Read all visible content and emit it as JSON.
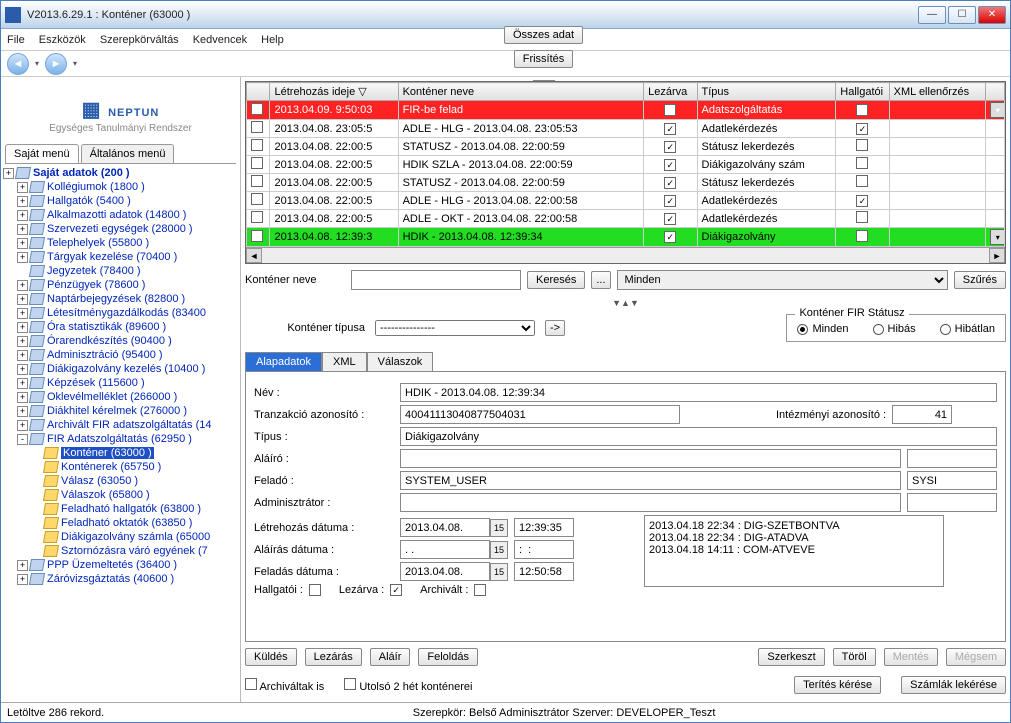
{
  "window": {
    "title": "V2013.6.29.1 : Konténer (63000  )"
  },
  "menu": [
    "File",
    "Eszközök",
    "Szerepkörváltás",
    "Kedvencek",
    "Help"
  ],
  "toolbar": {
    "all": "Összes adat",
    "refresh": "Frissítés"
  },
  "logo": {
    "brand": "NEPTUN",
    "tag": "Egységes Tanulmányi Rendszer"
  },
  "leftTabs": [
    "Saját menü",
    "Általános menü"
  ],
  "tree": [
    {
      "pm": "+",
      "b": true,
      "l": "Saját adatok (200  )"
    },
    {
      "pm": "+",
      "l": "Kollégiumok (1800  )",
      "i": 1
    },
    {
      "pm": "+",
      "l": "Hallgatók (5400  )",
      "i": 1
    },
    {
      "pm": "+",
      "l": "Alkalmazotti adatok (14800  )",
      "i": 1
    },
    {
      "pm": "+",
      "l": "Szervezeti egységek (28000  )",
      "i": 1
    },
    {
      "pm": "+",
      "l": "Telephelyek (55800  )",
      "i": 1
    },
    {
      "pm": "+",
      "l": "Tárgyak kezelése (70400  )",
      "i": 1
    },
    {
      "pm": "",
      "l": "Jegyzetek (78400  )",
      "i": 1
    },
    {
      "pm": "+",
      "l": "Pénzügyek (78600  )",
      "i": 1
    },
    {
      "pm": "+",
      "l": "Naptárbejegyzések (82800  )",
      "i": 1
    },
    {
      "pm": "+",
      "l": "Létesítménygazdálkodás (83400",
      "i": 1
    },
    {
      "pm": "+",
      "l": "Óra statisztikák (89600  )",
      "i": 1
    },
    {
      "pm": "+",
      "l": "Órarendkészítés (90400  )",
      "i": 1
    },
    {
      "pm": "+",
      "l": "Adminisztráció (95400  )",
      "i": 1
    },
    {
      "pm": "+",
      "l": "Diákigazolvány kezelés (10400  )",
      "i": 1
    },
    {
      "pm": "+",
      "l": "Képzések (115600  )",
      "i": 1
    },
    {
      "pm": "+",
      "l": "Oklevélmelléklet (266000  )",
      "i": 1
    },
    {
      "pm": "+",
      "l": "Diákhitel kérelmek (276000  )",
      "i": 1
    },
    {
      "pm": "+",
      "l": "Archivált FIR adatszolgáltatás (14",
      "i": 1
    },
    {
      "pm": "-",
      "l": "FIR Adatszolgáltatás (62950  )",
      "i": 1
    },
    {
      "pm": "",
      "y": true,
      "sel": true,
      "l": "Konténer (63000  )",
      "i": 2
    },
    {
      "pm": "",
      "y": true,
      "l": "Konténerek (65750  )",
      "i": 2
    },
    {
      "pm": "",
      "y": true,
      "l": "Válasz (63050  )",
      "i": 2
    },
    {
      "pm": "",
      "y": true,
      "l": "Válaszok (65800  )",
      "i": 2
    },
    {
      "pm": "",
      "y": true,
      "l": "Feladható hallgatók (63800  )",
      "i": 2
    },
    {
      "pm": "",
      "y": true,
      "l": "Feladható oktatók (63850  )",
      "i": 2
    },
    {
      "pm": "",
      "y": true,
      "l": "Diákigazolvány számla (65000",
      "i": 2
    },
    {
      "pm": "",
      "y": true,
      "l": "Sztornózásra váró egyének (7",
      "i": 2
    },
    {
      "pm": "+",
      "l": "PPP Üzemeltetés (36400  )",
      "i": 1
    },
    {
      "pm": "+",
      "l": "Záróvizsgáztatás (40600  )",
      "i": 1
    }
  ],
  "gridCols": [
    "",
    "Létrehozás ideje",
    "Konténer neve",
    "Lezárva",
    "Típus",
    "Hallgatói",
    "XML ellenőrzés",
    ""
  ],
  "gridRows": [
    {
      "cls": "red",
      "t": "2013.04.09. 9:50:03",
      "n": "FIR-be felad",
      "lz": "✓",
      "tp": "Adatszolgáltatás",
      "h": "✓"
    },
    {
      "t": "2013.04.08. 23:05:5",
      "n": "ADLE - HLG - 2013.04.08. 23:05:53",
      "lz": "✓",
      "tp": "Adatlekérdezés",
      "h": "✓"
    },
    {
      "t": "2013.04.08. 22:00:5",
      "n": "STATUSZ - 2013.04.08. 22:00:59",
      "lz": "✓",
      "tp": "Státusz lekerdezés",
      "h": ""
    },
    {
      "t": "2013.04.08. 22:00:5",
      "n": "HDIK SZLA - 2013.04.08. 22:00:59",
      "lz": "✓",
      "tp": "Diákigazolvány szám",
      "h": ""
    },
    {
      "t": "2013.04.08. 22:00:5",
      "n": "STATUSZ - 2013.04.08. 22:00:59",
      "lz": "✓",
      "tp": "Státusz lekerdezés",
      "h": ""
    },
    {
      "t": "2013.04.08. 22:00:5",
      "n": "ADLE - HLG - 2013.04.08. 22:00:58",
      "lz": "✓",
      "tp": "Adatlekérdezés",
      "h": "✓"
    },
    {
      "t": "2013.04.08. 22:00:5",
      "n": "ADLE - OKT - 2013.04.08. 22:00:58",
      "lz": "✓",
      "tp": "Adatlekérdezés",
      "h": ""
    },
    {
      "cls": "green",
      "t": "2013.04.08. 12:39:3",
      "n": "HDIK - 2013.04.08. 12:39:34",
      "lz": "✓",
      "tp": "Diákigazolvány",
      "h": ""
    }
  ],
  "search": {
    "label": "Konténer neve",
    "btn": "Keresés",
    "dots": "...",
    "all": "Minden",
    "filter": "Szűrés"
  },
  "mid": {
    "typeLabel": "Konténer típusa",
    "typeVal": "---------------",
    "go": "->",
    "fsTitle": "Konténer FIR Státusz",
    "r1": "Minden",
    "r2": "Hibás",
    "r3": "Hibátlan"
  },
  "detTabs": [
    "Alapadatok",
    "XML",
    "Válaszok"
  ],
  "form": {
    "nev": "Név :",
    "nevV": "HDIK - 2013.04.08. 12:39:34",
    "tra": "Tranzakció azonosító :",
    "traV": "40041113040877504031",
    "int": "Intézményi azonosító :",
    "intV": "41",
    "tip": "Típus :",
    "tipV": "Diákigazolvány",
    "ala": "Aláíró :",
    "fel": "Feladó :",
    "felV": "SYSTEM_USER",
    "felV2": "SYSI",
    "adm": "Adminisztrátor :",
    "lh": "Létrehozás dátuma :",
    "lhD": "2013.04.08.",
    "lhT": "12:39:35",
    "ad": "Aláírás dátuma :",
    "adD": ". .",
    "adT": ":  :",
    "fd": "Feladás dátuma :",
    "fdD": "2013.04.08.",
    "fdT": "12:50:58",
    "hg": "Hallgatói :",
    "lz": "Lezárva :",
    "ar": "Archivált :",
    "memo": "2013.04.18 22:34 : DIG-SZETBONTVA\n2013.04.18 22:34 : DIG-ATADVA\n2013.04.18 14:11 : COM-ATVEVE"
  },
  "btns": {
    "kuldes": "Küldés",
    "lezaras": "Lezárás",
    "alair": "Aláír",
    "feloldas": "Feloldás",
    "szerk": "Szerkeszt",
    "torol": "Töröl",
    "mentes": "Mentés",
    "megsem": "Mégsem",
    "terites": "Terítés kérése",
    "szamlak": "Számlák lekérése"
  },
  "chks": {
    "arch": "Archiváltak is",
    "utolso": "Utolsó 2 hét konténerei"
  },
  "status": {
    "l": "Letöltve 286 rekord.",
    "m": "Szerepkör: Belső Adminisztrátor  Szerver: DEVELOPER_Teszt"
  }
}
